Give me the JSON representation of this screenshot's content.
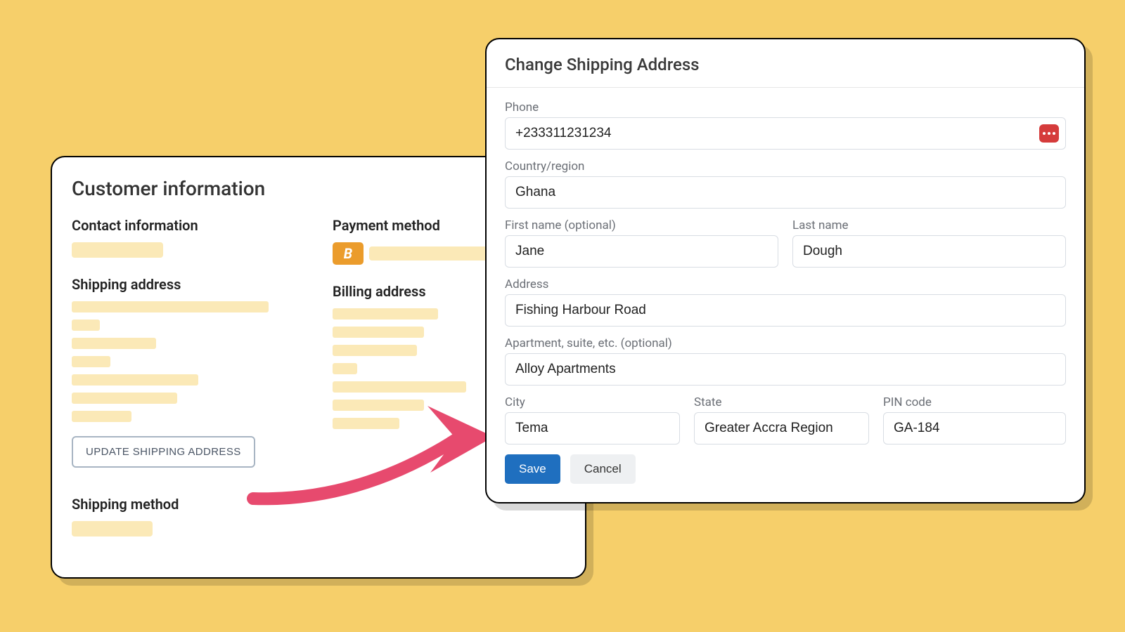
{
  "back": {
    "title": "Customer information",
    "contact_title": "Contact information",
    "payment_title": "Payment method",
    "payment_badge": "B",
    "shipping_title": "Shipping address",
    "billing_title": "Billing address",
    "update_btn": "UPDATE SHIPPING ADDRESS",
    "method_title": "Shipping method"
  },
  "modal": {
    "title": "Change Shipping Address",
    "labels": {
      "phone": "Phone",
      "country": "Country/region",
      "first": "First name (optional)",
      "last": "Last name",
      "address": "Address",
      "apt": "Apartment, suite, etc. (optional)",
      "city": "City",
      "state": "State",
      "pin": "PIN code"
    },
    "values": {
      "phone": "+233311231234",
      "country": "Ghana",
      "first": "Jane",
      "last": "Dough",
      "address": "Fishing Harbour Road",
      "apt": "Alloy Apartments",
      "city": "Tema",
      "state": "Greater Accra Region",
      "pin": "GA-184"
    },
    "save": "Save",
    "cancel": "Cancel"
  }
}
